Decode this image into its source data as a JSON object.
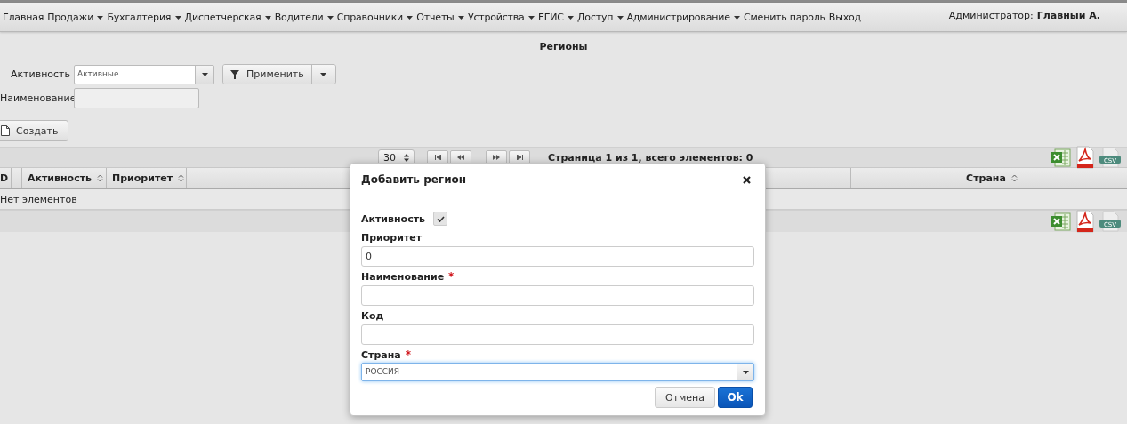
{
  "menu": {
    "items": [
      {
        "label": "Главная",
        "dropdown": false
      },
      {
        "label": "Продажи",
        "dropdown": true
      },
      {
        "label": "Бухгалтерия",
        "dropdown": true
      },
      {
        "label": "Диспетчерская",
        "dropdown": true
      },
      {
        "label": "Водители",
        "dropdown": true
      },
      {
        "label": "Справочники",
        "dropdown": true
      },
      {
        "label": "Отчеты",
        "dropdown": true
      },
      {
        "label": "Устройства",
        "dropdown": true
      },
      {
        "label": "ЕГИС",
        "dropdown": true
      },
      {
        "label": "Доступ",
        "dropdown": true
      },
      {
        "label": "Администрирование",
        "dropdown": true
      },
      {
        "label": "Сменить пароль",
        "dropdown": false
      },
      {
        "label": "Выход",
        "dropdown": false
      }
    ],
    "user_label": "Администратор:",
    "user_name": "Главный А."
  },
  "page_title": "Регионы",
  "filters": [
    {
      "label": "Активность",
      "kind": "select",
      "value": "Активные"
    },
    {
      "label": "Наименование",
      "kind": "text"
    }
  ],
  "apply_button": "Применить",
  "create_button": "Создать",
  "paginator_top": {
    "page_size": "30",
    "summary": "Страница 1 из 1, всего элементов: 0",
    "exports": [
      {
        "kind": "excel"
      },
      {
        "kind": "pdf"
      },
      {
        "kind": "csv",
        "label": "CSV"
      }
    ]
  },
  "table": {
    "columns": [
      {
        "label": "D"
      },
      {
        "label": "Активность",
        "sortable": true
      },
      {
        "label": "Приоритет",
        "sortable": true
      },
      {
        "label": "Страна",
        "sortable": true
      }
    ],
    "empty_message": "Нет элементов"
  },
  "paginator_bottom": {
    "exports": [
      {
        "kind": "excel"
      },
      {
        "kind": "pdf"
      },
      {
        "kind": "csv",
        "label": "CSV"
      }
    ]
  },
  "dialog": {
    "title": "Добавить регион",
    "fields": [
      {
        "label": "Активность",
        "kind": "checkbox",
        "checked": true
      },
      {
        "label": "Приоритет",
        "kind": "text",
        "value": "0"
      },
      {
        "label": "Наименование",
        "kind": "text",
        "required_mark": "*"
      },
      {
        "label": "Код",
        "kind": "text"
      },
      {
        "label": "Страна",
        "kind": "select",
        "required_mark": "*",
        "value": "РОССИЯ",
        "focused": true
      }
    ],
    "cancel_button": "Отмена",
    "ok_button": "Ok"
  }
}
